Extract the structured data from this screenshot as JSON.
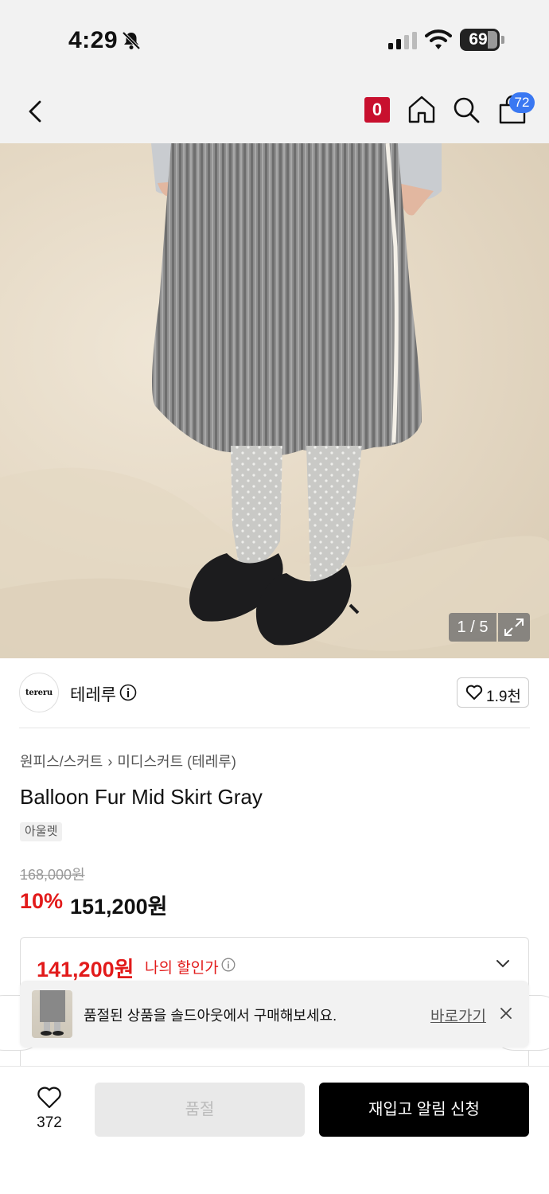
{
  "status_bar": {
    "time": "4:29",
    "battery": "69"
  },
  "nav": {
    "notification_count": "0",
    "cart_count": "72"
  },
  "hero": {
    "image_counter": "1 / 5"
  },
  "brand": {
    "logo_text": "tereru",
    "name": "테레루",
    "likes": "1.9천"
  },
  "product": {
    "breadcrumb": [
      "원피스/스커트",
      "미디스커트 (테레루)"
    ],
    "title": "Balloon Fur Mid Skirt Gray",
    "tag": "아울렛",
    "original_price": "168,000원",
    "discount_rate": "10%",
    "sale_price": "151,200원"
  },
  "my_discount": {
    "amount": "141,200원",
    "label": "나의 할인가"
  },
  "toast": {
    "message": "품절된 상품을 솔드아웃에서 구매해보세요.",
    "link": "바로가기"
  },
  "bottom_bar": {
    "wishlist_count": "372",
    "soldout_label": "품절",
    "restock_label": "재입고 알림 신청"
  },
  "colors": {
    "accent_red": "#e21b1b",
    "badge_blue": "#3a78f2",
    "badge_red": "#c8102e"
  }
}
